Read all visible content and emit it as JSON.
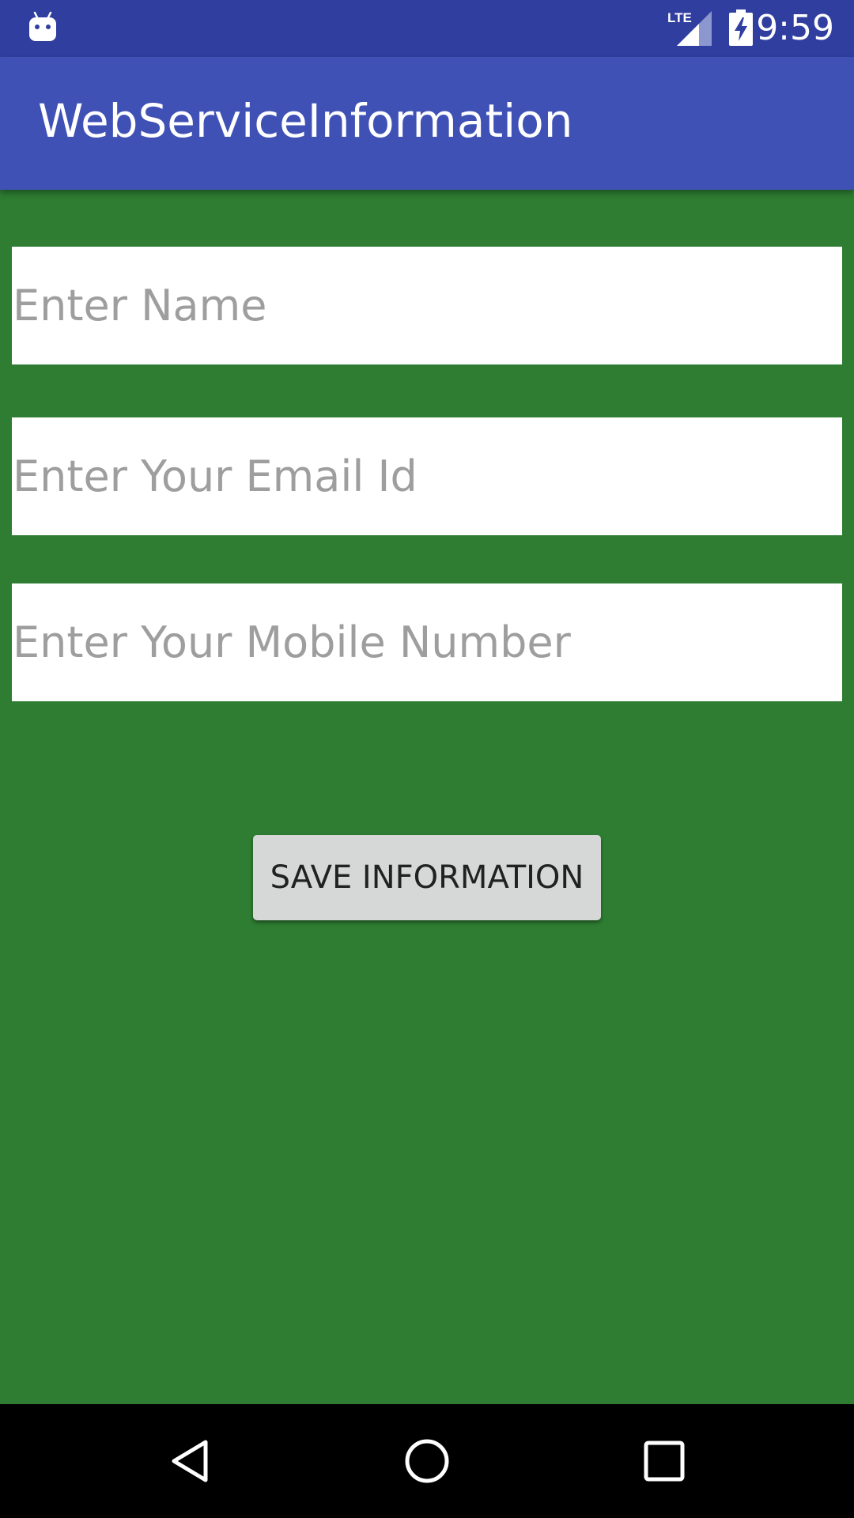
{
  "status_bar": {
    "time": "9:59",
    "network": "LTE",
    "icons": [
      "android-debug-icon",
      "lte-signal-icon",
      "battery-charging-icon"
    ]
  },
  "app_bar": {
    "title": "WebServiceInformation",
    "color": "#3F51B5"
  },
  "form": {
    "background": "#2E7D32",
    "name": {
      "value": "",
      "placeholder": "Enter Name"
    },
    "email": {
      "value": "",
      "placeholder": "Enter Your Email Id"
    },
    "mobile": {
      "value": "",
      "placeholder": "Enter Your Mobile Number"
    },
    "save_label": "SAVE INFORMATION"
  },
  "nav_bar": {
    "icons": [
      "back-icon",
      "home-icon",
      "recents-icon"
    ]
  }
}
